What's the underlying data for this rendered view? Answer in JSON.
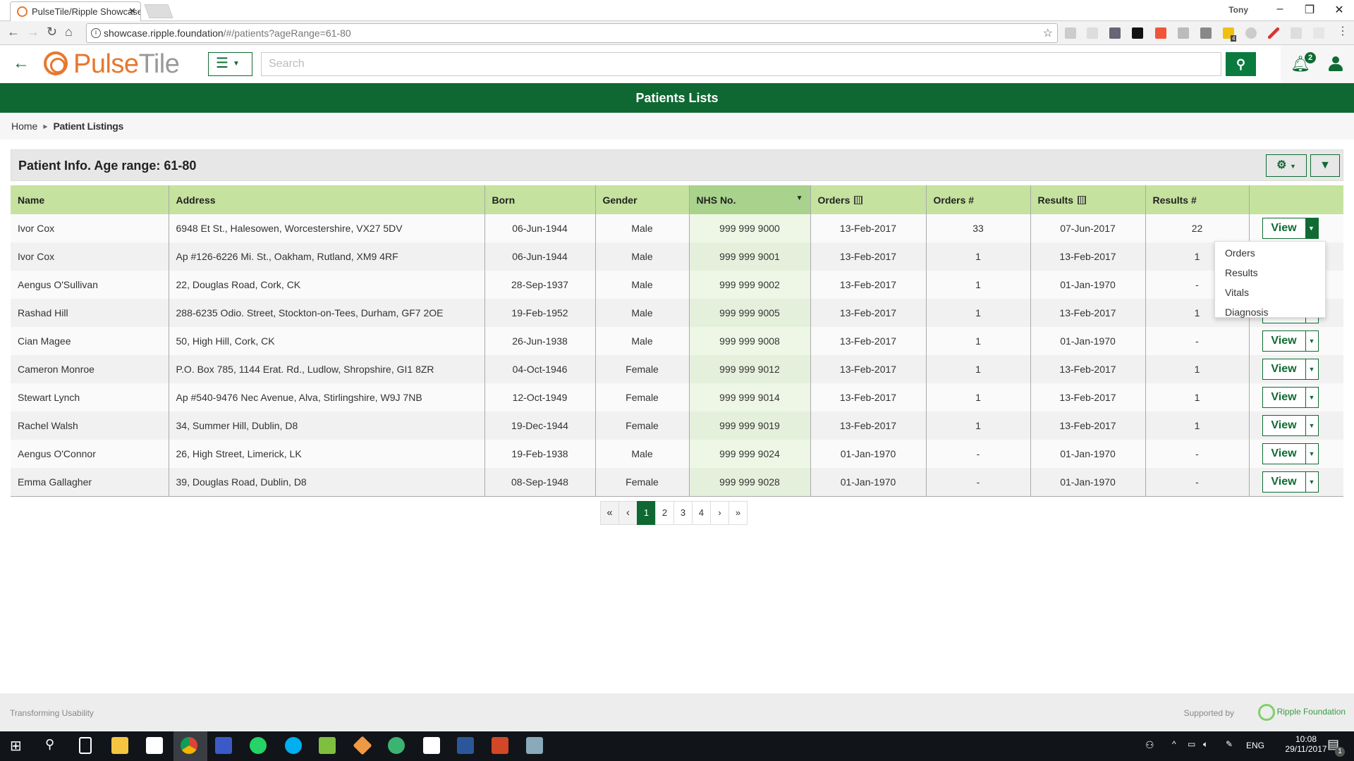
{
  "browser": {
    "tab_title": "PulseTile/Ripple Showcase",
    "tab_close": "✕",
    "user": "Tony",
    "url_host": "showcase.ripple.foundation",
    "url_path": "/#/patients?ageRange=61-80",
    "extension_badge": "4"
  },
  "header": {
    "logo_pulse": "Pulse",
    "logo_tile": "Tile",
    "search_placeholder": "Search",
    "notifications_count": "2"
  },
  "banner": {
    "title": "Patients Lists"
  },
  "breadcrumb": {
    "home": "Home",
    "current": "Patient Listings"
  },
  "panel": {
    "title": "Patient Info. Age range: 61-80"
  },
  "table": {
    "columns": [
      "Name",
      "Address",
      "Born",
      "Gender",
      "NHS No.",
      "Orders",
      "Orders #",
      "Results",
      "Results #",
      ""
    ],
    "sorted_column": "NHS No.",
    "view_label": "View",
    "rows": [
      [
        "Ivor Cox",
        "6948 Et St., Halesowen, Worcestershire, VX27 5DV",
        "06-Jun-1944",
        "Male",
        "999 999 9000",
        "13-Feb-2017",
        "33",
        "07-Jun-2017",
        "22"
      ],
      [
        "Ivor Cox",
        "Ap #126-6226 Mi. St., Oakham, Rutland, XM9 4RF",
        "06-Jun-1944",
        "Male",
        "999 999 9001",
        "13-Feb-2017",
        "1",
        "13-Feb-2017",
        "1"
      ],
      [
        "Aengus O'Sullivan",
        "22, Douglas Road, Cork, CK",
        "28-Sep-1937",
        "Male",
        "999 999 9002",
        "13-Feb-2017",
        "1",
        "01-Jan-1970",
        "-"
      ],
      [
        "Rashad Hill",
        "288-6235 Odio. Street, Stockton-on-Tees, Durham, GF7 2OE",
        "19-Feb-1952",
        "Male",
        "999 999 9005",
        "13-Feb-2017",
        "1",
        "13-Feb-2017",
        "1"
      ],
      [
        "Cian Magee",
        "50, High Hill, Cork, CK",
        "26-Jun-1938",
        "Male",
        "999 999 9008",
        "13-Feb-2017",
        "1",
        "01-Jan-1970",
        "-"
      ],
      [
        "Cameron Monroe",
        "P.O. Box 785, 1144 Erat. Rd., Ludlow, Shropshire, GI1 8ZR",
        "04-Oct-1946",
        "Female",
        "999 999 9012",
        "13-Feb-2017",
        "1",
        "13-Feb-2017",
        "1"
      ],
      [
        "Stewart Lynch",
        "Ap #540-9476 Nec Avenue, Alva, Stirlingshire, W9J 7NB",
        "12-Oct-1949",
        "Female",
        "999 999 9014",
        "13-Feb-2017",
        "1",
        "13-Feb-2017",
        "1"
      ],
      [
        "Rachel Walsh",
        "34, Summer Hill, Dublin, D8",
        "19-Dec-1944",
        "Female",
        "999 999 9019",
        "13-Feb-2017",
        "1",
        "13-Feb-2017",
        "1"
      ],
      [
        "Aengus O'Connor",
        "26, High Street, Limerick, LK",
        "19-Feb-1938",
        "Male",
        "999 999 9024",
        "01-Jan-1970",
        "-",
        "01-Jan-1970",
        "-"
      ],
      [
        "Emma Gallagher",
        "39, Douglas Road, Dublin, D8",
        "08-Sep-1948",
        "Female",
        "999 999 9028",
        "01-Jan-1970",
        "-",
        "01-Jan-1970",
        "-"
      ]
    ]
  },
  "view_dropdown": {
    "open_on_row": 0,
    "items": [
      "Orders",
      "Results",
      "Vitals",
      "Diagnosis"
    ]
  },
  "pagination": {
    "first": "«",
    "prev": "‹",
    "pages": [
      "1",
      "2",
      "3",
      "4"
    ],
    "current": "1",
    "next": "›",
    "last": "»"
  },
  "footer": {
    "left": "Transforming Usability",
    "supported_by": "Supported by",
    "sponsor": "Ripple Foundation"
  },
  "taskbar": {
    "language": "ENG",
    "time": "10:08",
    "date": "29/11/2017",
    "notifications": "1"
  },
  "colors": {
    "brand_green": "#0f6832",
    "header_green": "#c5e29e",
    "logo_orange": "#e8772e"
  }
}
